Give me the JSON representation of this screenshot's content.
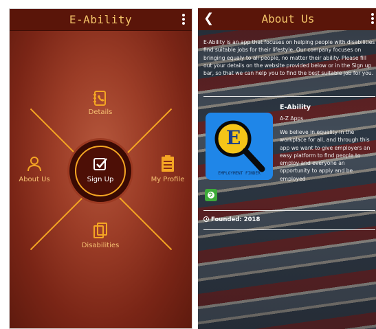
{
  "left_screen": {
    "app_title": "E-Ability",
    "menu": {
      "details": "Details",
      "about_us": "About Us",
      "sign_up": "Sign Up",
      "my_profile": "My Profile",
      "disabilities": "Disabilities"
    }
  },
  "right_screen": {
    "title": "About Us",
    "description": "E-Ability is an app that focuses on helping people with disabilities find suitable jobs for their lifestyle. Our company focuses on bringing equaly to all people, no matter their ability. Please fill out your details on the website provided below or in the Sign up bar, so that we can help you to find the best suitable job for you.",
    "app_name": "E-Ability",
    "developer": "A-Z Apps",
    "app_description": "We believe in equality in the workplace for all, and through this app we want to give employers an easy platform to find people to employ and everyone an opportunity to apply and be employed",
    "logo_letter": "E",
    "logo_caption": "EMPLOYMENT FINDER",
    "founded_label": "Founded:",
    "founded_year": "2018"
  },
  "colors": {
    "appbar": "#5a1509",
    "accent": "#f5a623",
    "title_text": "#f2c268",
    "logo_bg": "#1f86e8",
    "web_button": "#3eaa3a"
  },
  "icons": {
    "details": "contact-book-icon",
    "about_us": "person-icon",
    "sign_up": "checkbox-icon",
    "my_profile": "clipboard-icon",
    "disabilities": "documents-icon",
    "overflow": "kebab-menu-icon",
    "back": "back-arrow-icon",
    "website": "globe-icon",
    "founded": "clock-icon"
  }
}
